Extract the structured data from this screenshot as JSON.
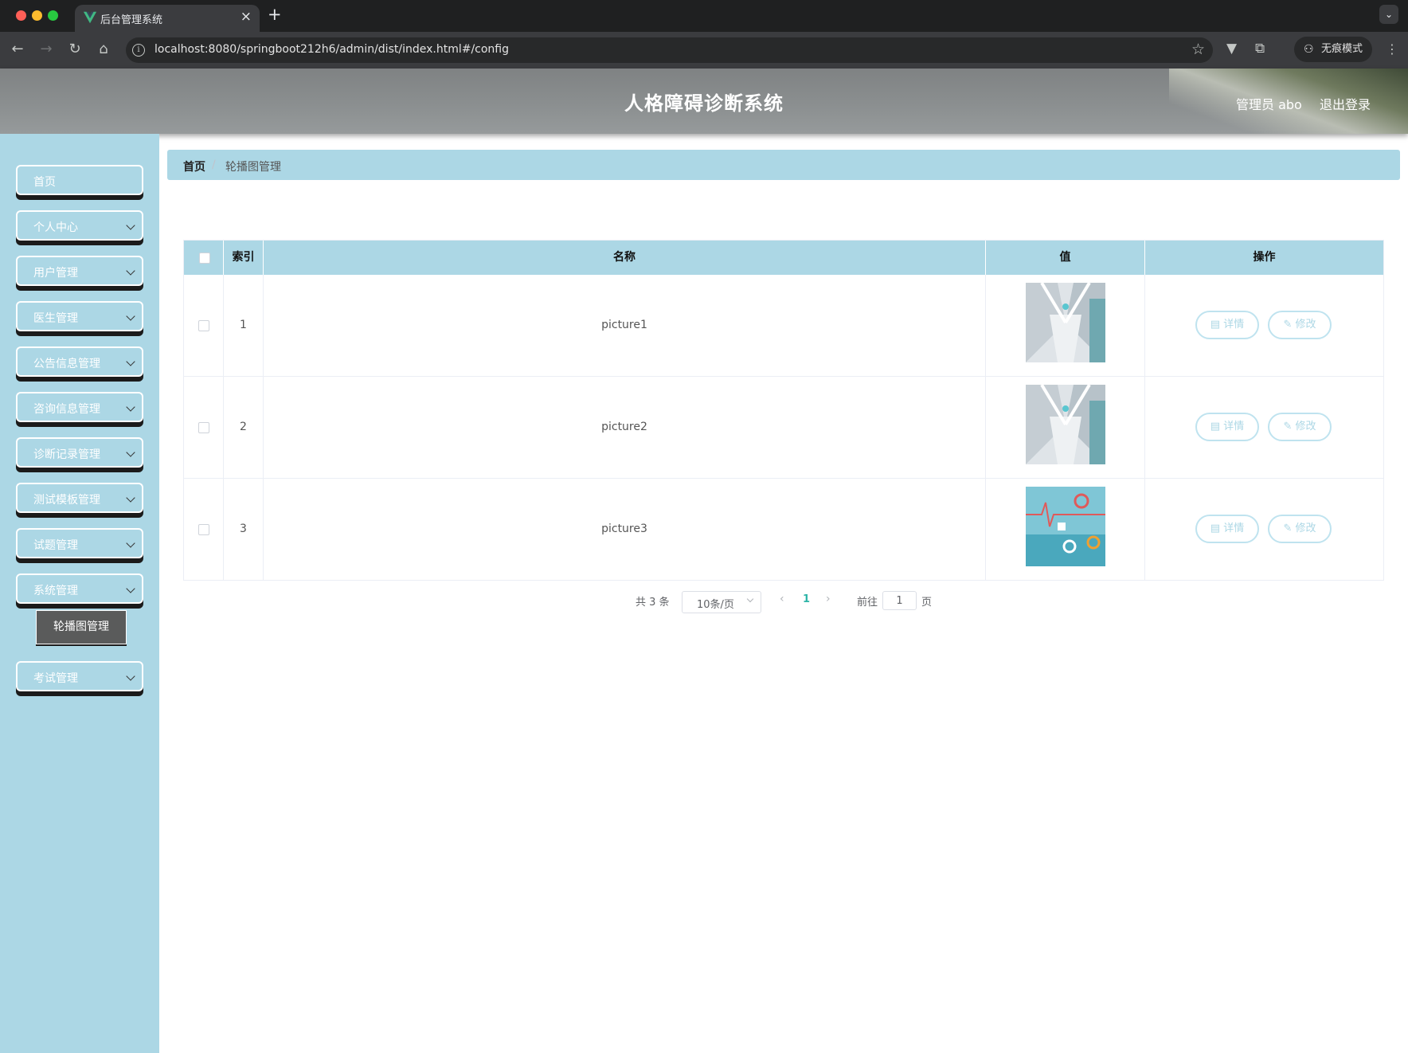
{
  "browser": {
    "tab_title": "后台管理系统",
    "url": "localhost:8080/springboot212h6/admin/dist/index.html#/config",
    "incognito_label": "无痕模式"
  },
  "header": {
    "title": "人格障碍诊断系统",
    "user_label": "管理员 abo",
    "logout_label": "退出登录"
  },
  "sidebar": {
    "items": [
      {
        "label": "首页",
        "expandable": false
      },
      {
        "label": "个人中心",
        "expandable": true
      },
      {
        "label": "用户管理",
        "expandable": true
      },
      {
        "label": "医生管理",
        "expandable": true
      },
      {
        "label": "公告信息管理",
        "expandable": true
      },
      {
        "label": "咨询信息管理",
        "expandable": true
      },
      {
        "label": "诊断记录管理",
        "expandable": true
      },
      {
        "label": "测试模板管理",
        "expandable": true
      },
      {
        "label": "试题管理",
        "expandable": true
      },
      {
        "label": "系统管理",
        "expandable": true
      },
      {
        "label": "考试管理",
        "expandable": true
      }
    ],
    "submenu_active": "轮播图管理"
  },
  "breadcrumb": {
    "home": "首页",
    "separator": "/",
    "current": "轮播图管理"
  },
  "table": {
    "columns": [
      "索引",
      "名称",
      "值",
      "操作"
    ],
    "rows": [
      {
        "index": "1",
        "name": "picture1",
        "image": "hospital-corridor"
      },
      {
        "index": "2",
        "name": "picture2",
        "image": "hospital-corridor"
      },
      {
        "index": "3",
        "name": "picture3",
        "image": "medical-ecg-pattern"
      }
    ],
    "actions": {
      "detail": "详情",
      "edit": "修改"
    }
  },
  "pagination": {
    "total_text": "共 3 条",
    "page_size": "10条/页",
    "current_page": "1",
    "goto_label": "前往",
    "goto_value": "1",
    "page_unit": "页"
  },
  "colors": {
    "accent": "#acd7e5",
    "header_bg": "#8c9091",
    "active_page": "#2fb5a8"
  }
}
